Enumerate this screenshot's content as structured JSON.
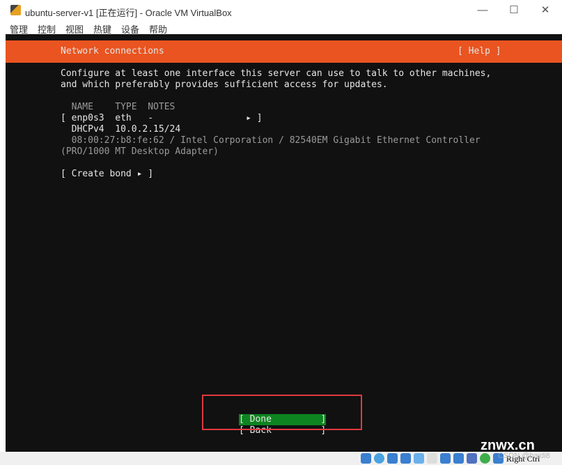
{
  "window": {
    "title": "ubuntu-server-v1 [正在运行] - Oracle VM VirtualBox",
    "minimize": "—",
    "maximize": "☐",
    "close": "✕"
  },
  "menu": [
    "管理",
    "控制",
    "视图",
    "热键",
    "设备",
    "帮助"
  ],
  "header": {
    "title": "Network connections",
    "help": "[ Help ]"
  },
  "intro": [
    "Configure at least one interface this server can use to talk to other machines,",
    "and which preferably provides sufficient access for updates."
  ],
  "table": {
    "header": "  NAME    TYPE  NOTES",
    "row": "[ enp0s3  eth   -                 ▸ ]",
    "dhcp": "  DHCPv4  10.0.2.15/24",
    "hw1": "  08:00:27:b8:fe:62 / Intel Corporation / 82540EM Gigabit Ethernet Controller",
    "hw2": "(PRO/1000 MT Desktop Adapter)"
  },
  "create_bond": "[ Create bond ▸ ]",
  "buttons": {
    "done": "[ Done         ]",
    "back": "[ Back         ]"
  },
  "statusbar": {
    "host_key": "Right Ctrl",
    "icons": [
      "hard-disk",
      "optical-drive",
      "audio",
      "network",
      "usb",
      "shared-folders",
      "display",
      "capture",
      "recording",
      "mouse-integration",
      "keyboard"
    ]
  },
  "watermark": {
    "site": "znwx.cn",
    "author": "CSDN @haidi8"
  },
  "colors": {
    "accent": "#e95420",
    "selected": "#0e8420",
    "background": "#111112"
  }
}
